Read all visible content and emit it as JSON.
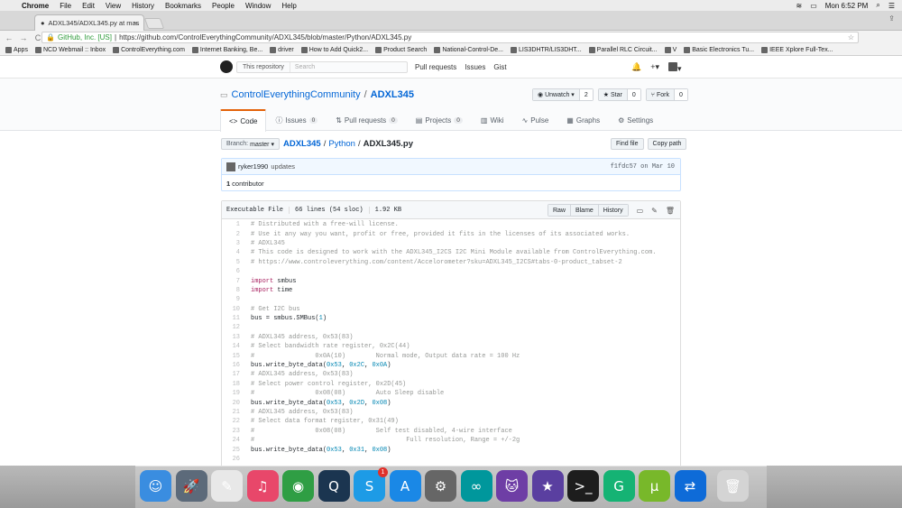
{
  "mac_menubar": {
    "apple": "",
    "app": "Chrome",
    "items": [
      "File",
      "Edit",
      "View",
      "History",
      "Bookmarks",
      "People",
      "Window",
      "Help"
    ],
    "clock": "Mon 6:52 PM"
  },
  "browser": {
    "tab_title": "ADXL345/ADXL345.py at mas",
    "tab_close": "×",
    "user_badge": "⇪",
    "back": "←",
    "forward": "→",
    "reload": "C",
    "secure_label": "GitHub, Inc. [US]",
    "url": "https://github.com/ControlEverythingCommunity/ADXL345/blob/master/Python/ADXL345.py",
    "bookmark_star": "☆"
  },
  "bookmarks": [
    "Apps",
    "NCD Webmail :: Inbox",
    "ControlEverything.com",
    "Internet Banking, Be...",
    "driver",
    "How to Add Quick2...",
    "Product Search",
    "National-Control-De...",
    "LIS3DHTR/LIS3DHT...",
    "Parallel RLC Circuit...",
    "V",
    "Basic Electronics Tu...",
    "IEEE Xplore Full-Tex..."
  ],
  "gh_header": {
    "scope": "This repository",
    "search_placeholder": "Search",
    "nav": [
      "Pull requests",
      "Issues",
      "Gist"
    ],
    "bell": "🔔",
    "plus": "+▾",
    "avatar_caret": "▾"
  },
  "repo": {
    "owner": "ControlEverythingCommunity",
    "separator": "/",
    "name": "ADXL345",
    "actions": [
      {
        "label": "Unwatch ▾",
        "icon": "eye-icon",
        "count": "2"
      },
      {
        "label": "Star",
        "icon": "star-icon",
        "count": "0"
      },
      {
        "label": "Fork",
        "icon": "fork-icon",
        "count": "0"
      }
    ],
    "tabs": [
      {
        "label": "Code",
        "icon": "code-icon",
        "count": ""
      },
      {
        "label": "Issues",
        "icon": "issue-icon",
        "count": "0"
      },
      {
        "label": "Pull requests",
        "icon": "pr-icon",
        "count": "0"
      },
      {
        "label": "Projects",
        "icon": "project-icon",
        "count": "0"
      },
      {
        "label": "Wiki",
        "icon": "wiki-icon",
        "count": ""
      },
      {
        "label": "Pulse",
        "icon": "pulse-icon",
        "count": ""
      },
      {
        "label": "Graphs",
        "icon": "graph-icon",
        "count": ""
      },
      {
        "label": "Settings",
        "icon": "gear-icon",
        "count": ""
      }
    ]
  },
  "file_nav": {
    "branch_label": "Branch:",
    "branch": "master ▾",
    "crumb_repo": "ADXL345",
    "sep1": "/",
    "crumb_dir": "Python",
    "sep2": "/",
    "crumb_file": "ADXL345.py",
    "find_file": "Find file",
    "copy_path": "Copy path"
  },
  "commit": {
    "author": "ryker1990",
    "message": "updates",
    "sha_date": "f1fdc57 on Mar 10",
    "contributors": "1",
    "contributors_label": "contributor"
  },
  "file": {
    "mode": "Executable File",
    "lines": "66 lines (54 sloc)",
    "size": "1.92 KB",
    "raw": "Raw",
    "blame": "Blame",
    "history": "History"
  },
  "code_lines": [
    {
      "n": "1",
      "t": "# Distributed with a free-will license."
    },
    {
      "n": "2",
      "t": "# Use it any way you want, profit or free, provided it fits in the licenses of its associated works."
    },
    {
      "n": "3",
      "t": "# ADXL345"
    },
    {
      "n": "4",
      "t": "# This code is designed to work with the ADXL345_I2CS I2C Mini Module available from ControlEverything.com."
    },
    {
      "n": "5",
      "t": "# https://www.controleverything.com/content/Accelorometer?sku=ADXL345_I2CS#tabs-0-product_tabset-2"
    },
    {
      "n": "6",
      "t": ""
    },
    {
      "n": "7",
      "t": "import smbus"
    },
    {
      "n": "8",
      "t": "import time"
    },
    {
      "n": "9",
      "t": ""
    },
    {
      "n": "10",
      "t": "# Get I2C bus"
    },
    {
      "n": "11",
      "t": "bus = smbus.SMBus(1)"
    },
    {
      "n": "12",
      "t": ""
    },
    {
      "n": "13",
      "t": "# ADXL345 address, 0x53(83)"
    },
    {
      "n": "14",
      "t": "# Select bandwidth rate register, 0x2C(44)"
    },
    {
      "n": "15",
      "t": "#\t\t0x0A(10)\tNormal mode, Output data rate = 100 Hz"
    },
    {
      "n": "16",
      "t": "bus.write_byte_data(0x53, 0x2C, 0x0A)"
    },
    {
      "n": "17",
      "t": "# ADXL345 address, 0x53(83)"
    },
    {
      "n": "18",
      "t": "# Select power control register, 0x2D(45)"
    },
    {
      "n": "19",
      "t": "#\t\t0x08(08)\tAuto Sleep disable"
    },
    {
      "n": "20",
      "t": "bus.write_byte_data(0x53, 0x2D, 0x08)"
    },
    {
      "n": "21",
      "t": "# ADXL345 address, 0x53(83)"
    },
    {
      "n": "22",
      "t": "# Select data format register, 0x31(49)"
    },
    {
      "n": "23",
      "t": "#\t\t0x08(08)\tSelf test disabled, 4-wire interface"
    },
    {
      "n": "24",
      "t": "#\t\t\t\t\tFull resolution, Range = +/-2g"
    },
    {
      "n": "25",
      "t": "bus.write_byte_data(0x53, 0x31, 0x08)"
    },
    {
      "n": "26",
      "t": ""
    }
  ],
  "dock": [
    {
      "icon": "finder-icon",
      "color": "#3a8de0",
      "glyph": "☺"
    },
    {
      "icon": "launchpad-icon",
      "color": "#5c6a7a",
      "glyph": "🚀"
    },
    {
      "icon": "textedit-icon",
      "color": "#e8e8e8",
      "glyph": "✎"
    },
    {
      "icon": "itunes-icon",
      "color": "#e8476a",
      "glyph": "♫"
    },
    {
      "icon": "chrome-icon",
      "color": "#2f9e44",
      "glyph": "◉"
    },
    {
      "icon": "quicktime-icon",
      "color": "#1b3550",
      "glyph": "Q"
    },
    {
      "icon": "skype-icon",
      "color": "#1d9be6",
      "glyph": "S",
      "badge": "1"
    },
    {
      "icon": "appstore-icon",
      "color": "#1a88e6",
      "glyph": "A"
    },
    {
      "icon": "system-preferences-icon",
      "color": "#666666",
      "glyph": "⚙"
    },
    {
      "icon": "arduino-icon",
      "color": "#00979c",
      "glyph": "∞"
    },
    {
      "icon": "github-desktop-icon",
      "color": "#6e3ea5",
      "glyph": "🐱"
    },
    {
      "icon": "imovie-icon",
      "color": "#5a3fa0",
      "glyph": "★"
    },
    {
      "icon": "terminal-icon",
      "color": "#1d1d1d",
      "glyph": ">_"
    },
    {
      "icon": "grammarly-icon",
      "color": "#15b374",
      "glyph": "G"
    },
    {
      "icon": "utorrent-icon",
      "color": "#78b82a",
      "glyph": "µ"
    },
    {
      "icon": "teamviewer-icon",
      "color": "#0e6bd8",
      "glyph": "⇄"
    },
    {
      "icon": "trash-icon",
      "color": "#d4d4d4",
      "glyph": "🗑"
    }
  ]
}
